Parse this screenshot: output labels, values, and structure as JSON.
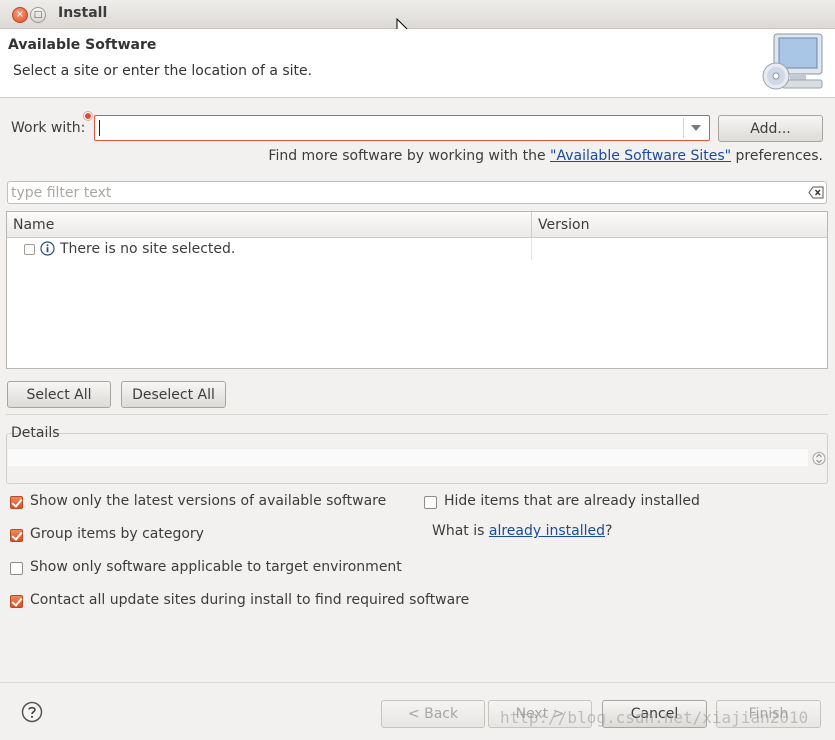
{
  "window": {
    "title": "Install",
    "close_glyph": "×",
    "maximize_glyph": "□"
  },
  "banner": {
    "title": "Available Software",
    "description": "Select a site or enter the location of a site."
  },
  "work_with": {
    "label": "Work with:",
    "value": "",
    "add_label": "Add...",
    "find_more_prefix": "Find more software by working with the ",
    "find_more_link": "\"Available Software Sites\"",
    "find_more_suffix": " preferences."
  },
  "filter": {
    "placeholder": "type filter text"
  },
  "table": {
    "columns": [
      "Name",
      "Version"
    ],
    "rows": [
      {
        "name": "There is no site selected.",
        "version": ""
      }
    ]
  },
  "buttons": {
    "select_all": "Select All",
    "deselect_all": "Deselect All"
  },
  "details": {
    "label": "Details"
  },
  "options": {
    "latest_versions": {
      "label": "Show only the latest versions of available software",
      "checked": true
    },
    "group_by_category": {
      "label": "Group items by category",
      "checked": true
    },
    "target_environment": {
      "label": "Show only software applicable to target environment",
      "checked": false
    },
    "contact_update_sites": {
      "label": "Contact all update sites during install to find required software",
      "checked": true
    },
    "hide_installed": {
      "label": "Hide items that are already installed",
      "checked": false
    },
    "what_is_prefix": "What is ",
    "what_is_link": "already installed",
    "what_is_suffix": "?"
  },
  "footer": {
    "back": "< Back",
    "next": "Next >",
    "cancel": "Cancel",
    "finish": "Finish"
  },
  "watermark": "http://blog.csdn.net/xiajian2010",
  "colors": {
    "accent": "#dd4f22",
    "link": "#1a4b9c",
    "error_border": "#e0573b"
  },
  "icons": [
    "close-icon",
    "maximize-icon",
    "cursor-icon",
    "monitor-cd-icon",
    "chevron-down-icon",
    "clear-filter-icon",
    "info-icon",
    "spinner-icon",
    "help-icon"
  ]
}
